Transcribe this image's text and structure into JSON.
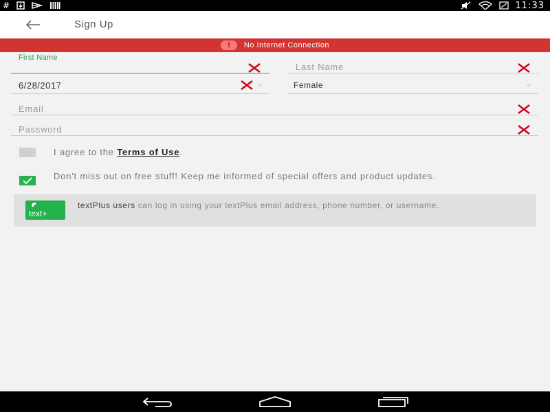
{
  "status_bar": {
    "left_icons": [
      "hash-icon",
      "download-icon",
      "cast-icon",
      "barcode-icon"
    ],
    "right_icons": [
      "mute-icon",
      "wifi-icon",
      "battery-icon"
    ],
    "time": "11:33"
  },
  "app_bar": {
    "title": "Sign Up",
    "back_icon": "arrow-left-icon"
  },
  "banner": {
    "icon": "alert-icon",
    "icon_glyph": "!",
    "text": "No Internet Connection",
    "color": "#d23431"
  },
  "form": {
    "first_name": {
      "label": "First Name",
      "value": "",
      "error": true
    },
    "last_name": {
      "placeholder": "Last Name",
      "value": "",
      "error": true
    },
    "birthdate": {
      "value": "6/28/2017",
      "error": true
    },
    "gender": {
      "value": "Female"
    },
    "email": {
      "placeholder": "Email",
      "value": "",
      "error": true
    },
    "password": {
      "placeholder": "Password",
      "value": "",
      "error": true
    }
  },
  "agree_terms": {
    "checked": false,
    "text_before": "I agree to the ",
    "link": "Terms of Use",
    "text_after": "."
  },
  "newsletter": {
    "checked": true,
    "text": "Don't miss out on free stuff! Keep me informed of special offers and product updates."
  },
  "info_card": {
    "logo_text": "text+",
    "strong": "textPlus users",
    "text": " can log in using your textPlus email address, phone number, or username."
  },
  "colors": {
    "accent": "#1aa54a",
    "error": "#d0021b",
    "checkbox_checked": "#2bb24c"
  },
  "nav_bar": {
    "buttons": [
      "back-nav-icon",
      "home-nav-icon",
      "recents-nav-icon"
    ]
  }
}
